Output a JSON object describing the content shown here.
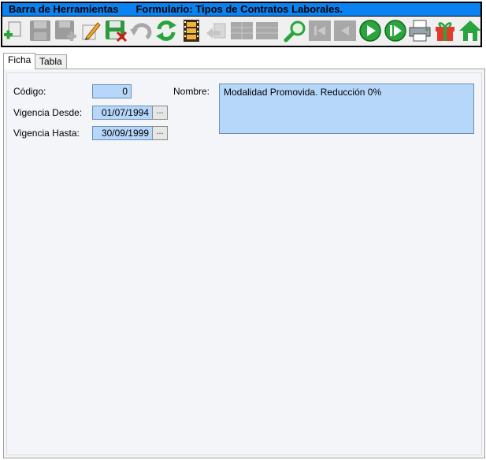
{
  "toolbar": {
    "title": "Barra de Herramientas",
    "form_title": "Formulario: Tipos de Contratos Laborales.",
    "buttons": [
      {
        "name": "add-record-icon",
        "enabled": true
      },
      {
        "name": "save-disk-icon",
        "enabled": false
      },
      {
        "name": "save-add-disk-icon",
        "enabled": false
      },
      {
        "name": "pencil-edit-icon",
        "enabled": true
      },
      {
        "name": "delete-disk-icon",
        "enabled": true
      },
      {
        "name": "undo-icon",
        "enabled": false
      },
      {
        "name": "refresh-icon",
        "enabled": true
      },
      {
        "name": "film-strip-icon",
        "enabled": true
      },
      {
        "name": "return-arrow-icon",
        "enabled": false
      },
      {
        "name": "grid-icon",
        "enabled": false
      },
      {
        "name": "grid-alt-icon",
        "enabled": false
      },
      {
        "name": "magnifier-icon",
        "enabled": true
      },
      {
        "name": "first-record-icon",
        "enabled": false
      },
      {
        "name": "previous-record-icon",
        "enabled": false
      },
      {
        "name": "next-record-icon",
        "enabled": true
      },
      {
        "name": "last-record-icon",
        "enabled": true
      },
      {
        "name": "printer-icon",
        "enabled": true
      },
      {
        "name": "gift-icon",
        "enabled": true
      },
      {
        "name": "home-icon",
        "enabled": true
      }
    ]
  },
  "tabs": [
    {
      "label": "Ficha",
      "active": true
    },
    {
      "label": "Tabla",
      "active": false
    }
  ],
  "form": {
    "codigo_label": "Código:",
    "codigo_value": "0",
    "vigencia_desde_label": "Vigencia Desde:",
    "vigencia_desde_value": "01/07/1994",
    "vigencia_hasta_label": "Vigencia Hasta:",
    "vigencia_hasta_value": "30/09/1999",
    "nombre_label": "Nombre:",
    "nombre_value": "Modalidad Promovida. Reducción 0%",
    "ellipsis": "..."
  },
  "colors": {
    "title_bar": "#0a82f0",
    "field_bg": "#b6d7fa",
    "panel_bg": "#f4f5f9",
    "green": "#28a23a",
    "disabled": "#9c9c9c"
  }
}
